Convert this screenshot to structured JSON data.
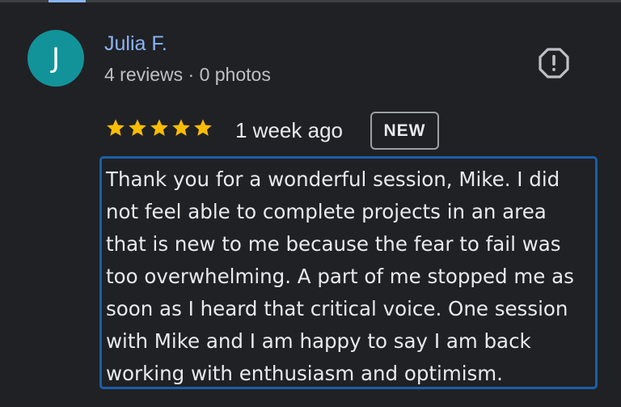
{
  "reviewer": {
    "initial": "J",
    "name": "Julia F.",
    "meta": "4 reviews · 0 photos",
    "avatar_color": "#12939a"
  },
  "report_icon": "report-octagon-icon",
  "review": {
    "rating": 5,
    "rating_max": 5,
    "star_color": "#fbbc04",
    "time": "1 week ago",
    "badge": "NEW",
    "text": "Thank you for a wonderful session, Mike. I did\nnot feel able to complete projects in an area\nthat is new to me because the fear to fail was\ntoo overwhelming. A part of me stopped me as\nsoon as I heard that critical voice. One session\nwith Mike and I am happy to say I am back\nworking with enthusiasm and optimism."
  },
  "colors": {
    "background": "#202124",
    "link": "#8ab4f8",
    "highlight_border": "#1a5fa8"
  }
}
